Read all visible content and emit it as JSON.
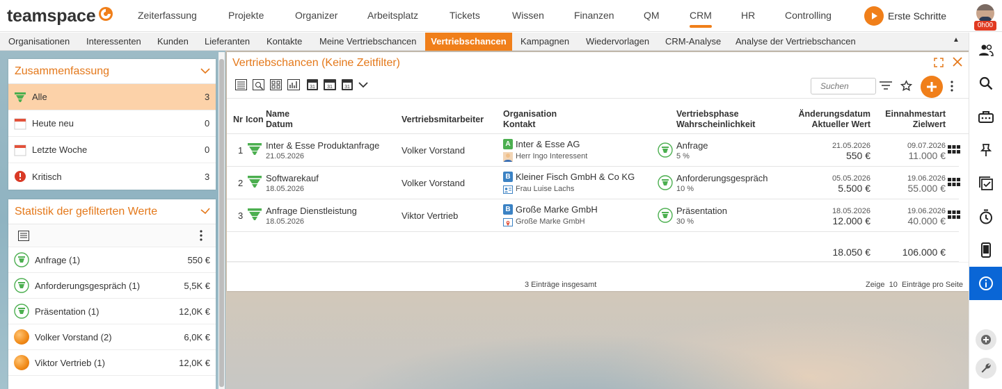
{
  "app": {
    "logo_text": "teamspace",
    "main_nav": [
      "Zeiterfassung",
      "Projekte",
      "Organizer",
      "Arbeitsplatz",
      "Tickets",
      "Wissen",
      "Finanzen",
      "QM",
      "CRM",
      "HR",
      "Controlling"
    ],
    "active_main_nav": "CRM",
    "getting_started_label": "Erste Schritte",
    "user_timer": "0h00"
  },
  "sub_nav": [
    "Organisationen",
    "Interessenten",
    "Kunden",
    "Lieferanten",
    "Kontakte",
    "Meine Vertriebschancen",
    "Vertriebschancen",
    "Kampagnen",
    "Wiedervorlagen",
    "CRM-Analyse",
    "Analyse der Vertriebschancen"
  ],
  "active_sub_nav": "Vertriebschancen",
  "summary": {
    "title": "Zusammenfassung",
    "items": [
      {
        "label": "Alle",
        "count": "3",
        "icon": "funnel-icon",
        "active": true
      },
      {
        "label": "Heute neu",
        "count": "0",
        "icon": "calendar-icon"
      },
      {
        "label": "Letzte Woche",
        "count": "0",
        "icon": "calendar-icon"
      },
      {
        "label": "Kritisch",
        "count": "3",
        "icon": "alert-icon"
      }
    ]
  },
  "stats": {
    "title": "Statistik der gefilterten Werte",
    "items": [
      {
        "label": "Anfrage (1)",
        "value": "550 €",
        "icon": "phase-icon"
      },
      {
        "label": "Anforderungsgespräch (1)",
        "value": "5,5K €",
        "icon": "phase-icon"
      },
      {
        "label": "Präsentation (1)",
        "value": "12,0K €",
        "icon": "phase-icon"
      },
      {
        "label": "Volker Vorstand (2)",
        "value": "6,0K €",
        "icon": "person-ball-icon"
      },
      {
        "label": "Viktor Vertrieb (1)",
        "value": "12,0K €",
        "icon": "person-ball-icon"
      }
    ]
  },
  "main": {
    "title": "Vertriebschancen (Keine Zeitfilter)",
    "search_placeholder": "Suchen",
    "columns": {
      "nr": "Nr",
      "icon": "Icon",
      "name": "Name",
      "date": "Datum",
      "employee": "Vertriebsmitarbeiter",
      "organisation": "Organisation",
      "contact": "Kontakt",
      "phase": "Vertriebsphase",
      "probability": "Wahrscheinlichkeit",
      "changed": "Änderungsdatum",
      "current_value": "Aktueller Wert",
      "revenue_start": "Einnahmestart",
      "target_value": "Zielwert"
    },
    "rows": [
      {
        "nr": "1",
        "name": "Inter & Esse Produktanfrage",
        "date": "21.05.2026",
        "employee": "Volker Vorstand",
        "org_badge": "A",
        "org_color": "#4caf50",
        "organisation": "Inter & Esse AG",
        "contact": "Herr Ingo Interessent",
        "phase": "Anfrage",
        "probability": "5 %",
        "changed": "21.05.2026",
        "current_value": "550 €",
        "revenue_start": "09.07.2026",
        "target_value": "11.000 €"
      },
      {
        "nr": "2",
        "name": "Softwarekauf",
        "date": "18.05.2026",
        "employee": "Volker Vorstand",
        "org_badge": "B",
        "org_color": "#3b82c4",
        "organisation": "Kleiner Fisch GmbH & Co KG",
        "contact": "Frau Luise Lachs",
        "phase": "Anforderungsgespräch",
        "probability": "10 %",
        "changed": "05.05.2026",
        "current_value": "5.500 €",
        "revenue_start": "19.06.2026",
        "target_value": "55.000 €"
      },
      {
        "nr": "3",
        "name": "Anfrage Dienstleistung",
        "date": "18.05.2026",
        "employee": "Viktor Vertrieb",
        "org_badge": "B",
        "org_color": "#3b82c4",
        "organisation": "Große Marke GmbH",
        "contact": "Große Marke GmbH",
        "phase": "Präsentation",
        "probability": "30 %",
        "changed": "18.05.2026",
        "current_value": "12.000 €",
        "revenue_start": "19.06.2026",
        "target_value": "40.000 €"
      }
    ],
    "totals": {
      "current_value": "18.050 €",
      "target_value": "106.000 €"
    },
    "footer": {
      "total_text": "3 Einträge insgesamt",
      "page_size_text": "Zeige  10  Einträge pro Seite"
    }
  },
  "colors": {
    "accent": "#f07f1a",
    "accent_text": "#e4781a",
    "active_blue": "#0a66d6",
    "funnel_green": "#4caf50"
  }
}
